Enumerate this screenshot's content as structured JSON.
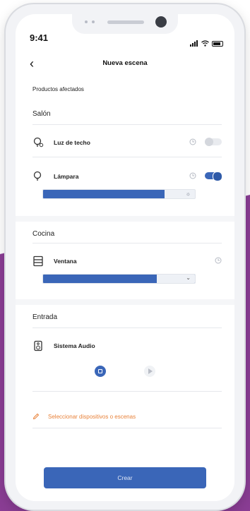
{
  "status_bar": {
    "time": "9:41"
  },
  "nav": {
    "back_glyph": "‹",
    "title": "Nueva escena"
  },
  "section_header": "Productos afectados",
  "rooms": [
    {
      "name": "Salón",
      "devices": [
        {
          "name": "Luz de techo",
          "icon": "bulb-icon",
          "timer": true,
          "toggle_on": false
        },
        {
          "name": "Lámpara",
          "icon": "bulb-icon",
          "timer": true,
          "toggle_on": true,
          "brightness_level": 0.8
        }
      ]
    },
    {
      "name": "Cocina",
      "devices": [
        {
          "name": "Ventana",
          "icon": "window-icon",
          "timer": true,
          "position_level": 0.75
        }
      ]
    },
    {
      "name": "Entrada",
      "devices": [
        {
          "name": "Sistema Audio",
          "icon": "speaker-icon",
          "controls": [
            "stop-icon",
            "play-icon"
          ]
        }
      ]
    }
  ],
  "select_devices_label": "Seleccionar dispositivos o escenas",
  "create_button": "Crear",
  "colors": {
    "accent": "#3a66b8",
    "orange": "#e8823a",
    "background_purple": "#8a3d94",
    "text": "#222222"
  }
}
